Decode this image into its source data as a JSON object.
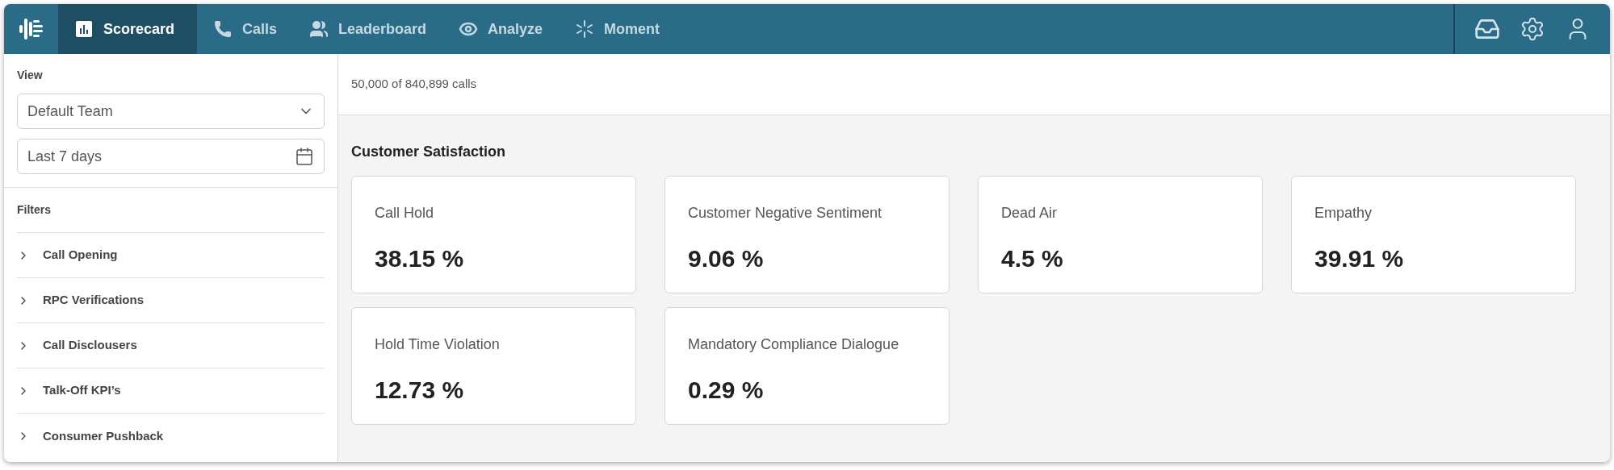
{
  "nav": {
    "tabs": [
      {
        "label": "Scorecard",
        "selected": true
      },
      {
        "label": "Calls",
        "selected": false
      },
      {
        "label": "Leaderboard",
        "selected": false
      },
      {
        "label": "Analyze",
        "selected": false
      },
      {
        "label": "Moment",
        "selected": false
      }
    ]
  },
  "sidebar": {
    "view_label": "View",
    "team_select": {
      "value": "Default Team"
    },
    "date_field": {
      "value": "Last 7 days"
    },
    "filters_label": "Filters",
    "filters": [
      {
        "label": "Call Opening",
        "expanded": false
      },
      {
        "label": "RPC Verifications",
        "expanded": false
      },
      {
        "label": "Call Disclousers",
        "expanded": false
      },
      {
        "label": "Talk-Off KPI’s",
        "expanded": false
      },
      {
        "label": "Consumer Pushback",
        "expanded": false
      }
    ]
  },
  "summary": "50,000 of 840,899 calls",
  "section": {
    "title": "Customer Satisfaction",
    "cards": [
      {
        "label": "Call Hold",
        "value": "38.15 %"
      },
      {
        "label": "Customer Negative Sentiment",
        "value": "9.06 %"
      },
      {
        "label": "Dead Air",
        "value": "4.5 %"
      },
      {
        "label": "Empathy",
        "value": "39.91 %"
      },
      {
        "label": "Hold Time Violation",
        "value": "12.73 %"
      },
      {
        "label": "Mandatory Compliance Dialogue",
        "value": "0.29 %"
      }
    ]
  }
}
